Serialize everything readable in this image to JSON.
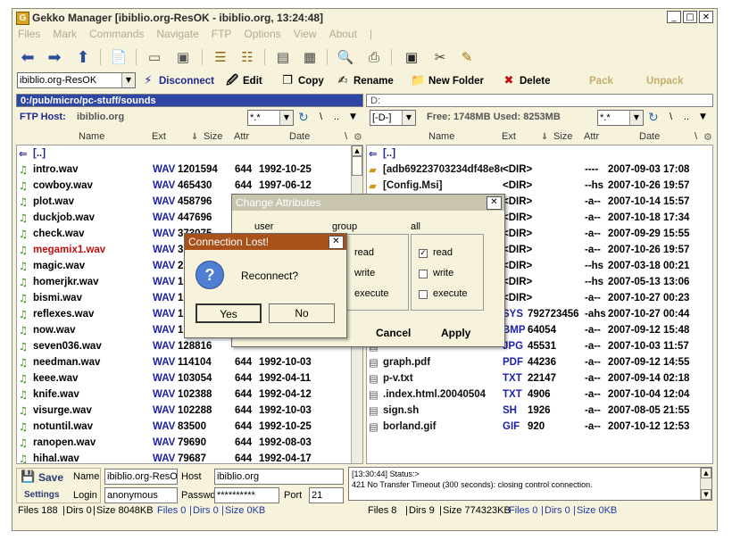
{
  "window": {
    "title": "Gekko Manager [ibiblio.org-ResOK - ibiblio.org, 13:24:48]"
  },
  "menu": [
    "Files",
    "Mark",
    "Commands",
    "Navigate",
    "FTP",
    "Options",
    "View",
    "About",
    "|"
  ],
  "toolbar2": {
    "site_combo": "ibiblio.org-ResOK",
    "disconnect": "Disconnect",
    "edit": "Edit",
    "copy": "Copy",
    "rename": "Rename",
    "new_folder": "New Folder",
    "delete": "Delete",
    "pack": "Pack",
    "unpack": "Unpack"
  },
  "left_panel": {
    "path": "0:/pub/micro/pc-stuff/sounds",
    "host_label": "FTP Host:",
    "host": "ibiblio.org",
    "filter": "*.*",
    "columns": {
      "name": "Name",
      "ext": "Ext",
      "size": "Size",
      "attr": "Attr",
      "date": "Date"
    },
    "updir": "[..]",
    "files": [
      {
        "name": "intro.wav",
        "ext": "WAV",
        "size": "1201594",
        "attr": "644",
        "date": "1992-10-25"
      },
      {
        "name": "cowboy.wav",
        "ext": "WAV",
        "size": "465430",
        "attr": "644",
        "date": "1997-06-12"
      },
      {
        "name": "plot.wav",
        "ext": "WAV",
        "size": "458796",
        "attr": "644",
        "date": "1992-10-25"
      },
      {
        "name": "duckjob.wav",
        "ext": "WAV",
        "size": "447696",
        "attr": "644",
        "date": "1992-10-25"
      },
      {
        "name": "check.wav",
        "ext": "WAV",
        "size": "373075",
        "attr": "644",
        "date": "1992-10-25"
      },
      {
        "name": "megamix1.wav",
        "ext": "WAV",
        "size": "3",
        "attr": "",
        "date": ""
      },
      {
        "name": "magic.wav",
        "ext": "WAV",
        "size": "2",
        "attr": "",
        "date": ""
      },
      {
        "name": "homerjkr.wav",
        "ext": "WAV",
        "size": "1",
        "attr": "",
        "date": ""
      },
      {
        "name": "bismi.wav",
        "ext": "WAV",
        "size": "1",
        "attr": "",
        "date": ""
      },
      {
        "name": "reflexes.wav",
        "ext": "WAV",
        "size": "1",
        "attr": "",
        "date": ""
      },
      {
        "name": "now.wav",
        "ext": "WAV",
        "size": "1",
        "attr": "",
        "date": ""
      },
      {
        "name": "seven036.wav",
        "ext": "WAV",
        "size": "128816",
        "attr": "",
        "date": ""
      },
      {
        "name": "needman.wav",
        "ext": "WAV",
        "size": "114104",
        "attr": "644",
        "date": "1992-10-03"
      },
      {
        "name": "keee.wav",
        "ext": "WAV",
        "size": "103054",
        "attr": "644",
        "date": "1992-04-11"
      },
      {
        "name": "knife.wav",
        "ext": "WAV",
        "size": "102388",
        "attr": "644",
        "date": "1992-04-12"
      },
      {
        "name": "visurge.wav",
        "ext": "WAV",
        "size": "102288",
        "attr": "644",
        "date": "1992-10-03"
      },
      {
        "name": "notuntil.wav",
        "ext": "WAV",
        "size": "83500",
        "attr": "644",
        "date": "1992-10-25"
      },
      {
        "name": "ranopen.wav",
        "ext": "WAV",
        "size": "79690",
        "attr": "644",
        "date": "1992-08-03"
      },
      {
        "name": "hihal.wav",
        "ext": "WAV",
        "size": "79687",
        "attr": "644",
        "date": "1992-04-17"
      }
    ],
    "status": {
      "files": "Files 188",
      "dirs": "Dirs 0",
      "size": "Size 8048KB",
      "sel_files": "Files 0",
      "sel_dirs": "Dirs 0",
      "sel_size": "Size 0KB"
    }
  },
  "right_panel": {
    "path": "D:",
    "drive": "[-D-]",
    "free": "Free: 1748MB Used: 8253MB",
    "filter": "*.*",
    "columns": {
      "name": "Name",
      "ext": "Ext",
      "size": "Size",
      "attr": "Attr",
      "date": "Date"
    },
    "updir": "[..]",
    "files": [
      {
        "name": "[adb69223703234df48e8e9f",
        "ext": "<DIR>",
        "size": "",
        "attr": "----",
        "date": "2007-09-03 17:08"
      },
      {
        "name": "[Config.Msi]",
        "ext": "<DIR>",
        "size": "",
        "attr": "--hs",
        "date": "2007-10-26 19:57"
      },
      {
        "name": "s]",
        "ext": "<DIR>",
        "size": "",
        "attr": "-a--",
        "date": "2007-10-14 15:57"
      },
      {
        "name": "",
        "ext": "<DIR>",
        "size": "",
        "attr": "-a--",
        "date": "2007-10-18 17:34"
      },
      {
        "name": "",
        "ext": "<DIR>",
        "size": "",
        "attr": "-a--",
        "date": "2007-09-29 15:55"
      },
      {
        "name": "",
        "ext": "<DIR>",
        "size": "",
        "attr": "-a--",
        "date": "2007-10-26 19:57"
      },
      {
        "name": "",
        "ext": "<DIR>",
        "size": "",
        "attr": "--hs",
        "date": "2007-03-18 00:21"
      },
      {
        "name": "ation",
        "ext": "<DIR>",
        "size": "",
        "attr": "--hs",
        "date": "2007-05-13 13:06"
      },
      {
        "name": "",
        "ext": "<DIR>",
        "size": "",
        "attr": "-a--",
        "date": "2007-10-27 00:23"
      },
      {
        "name": "",
        "ext": "SYS",
        "size": "792723456",
        "attr": "-ahs",
        "date": "2007-10-27 00:44"
      },
      {
        "name": "",
        "ext": "BMP",
        "size": "64054",
        "attr": "-a--",
        "date": "2007-09-12 15:48"
      },
      {
        "name": "",
        "ext": "JPG",
        "size": "45531",
        "attr": "-a--",
        "date": "2007-10-03 11:57"
      },
      {
        "name": "graph.pdf",
        "ext": "PDF",
        "size": "44236",
        "attr": "-a--",
        "date": "2007-09-12 14:55"
      },
      {
        "name": "p-v.txt",
        "ext": "TXT",
        "size": "22147",
        "attr": "-a--",
        "date": "2007-09-14 02:18"
      },
      {
        "name": ".index.html.20040504",
        "ext": "TXT",
        "size": "4906",
        "attr": "-a--",
        "date": "2007-10-04 12:04"
      },
      {
        "name": "sign.sh",
        "ext": "SH",
        "size": "1926",
        "attr": "-a--",
        "date": "2007-08-05 21:55"
      },
      {
        "name": "borland.gif",
        "ext": "GIF",
        "size": "920",
        "attr": "-a--",
        "date": "2007-10-12 12:53"
      }
    ],
    "status": {
      "files": "Files 8",
      "dirs": "Dirs 9",
      "size": "Size 774323KB",
      "sel_files": "Files 0",
      "sel_dirs": "Dirs 0",
      "sel_size": "Size 0KB"
    }
  },
  "connection": {
    "save": "Save",
    "settings": "Settings",
    "name_label": "Name",
    "name_value": "ibiblio.org-ResOK",
    "host_label": "Host",
    "host_value": "ibiblio.org",
    "login_label": "Login",
    "login_value": "anonymous",
    "password_label": "Passwd",
    "password_value": "**********",
    "port_label": "Port",
    "port_value": "21"
  },
  "log": {
    "line1": "[13:30:44] Status:>",
    "line2": "421 No Transfer Timeout (300 seconds): closing control connection."
  },
  "change_attributes": {
    "title": "Change Attributes",
    "col_user": "user",
    "col_group": "group",
    "col_all": "all",
    "read": "read",
    "write": "write",
    "execute": "execute",
    "cancel": "Cancel",
    "apply": "Apply"
  },
  "connection_lost": {
    "title": "Connection Lost!",
    "message": "Reconnect?",
    "yes": "Yes",
    "no": "No"
  }
}
